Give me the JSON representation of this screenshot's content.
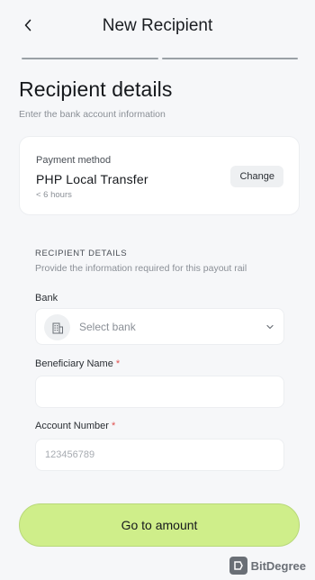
{
  "header": {
    "title": "New Recipient",
    "back_icon": "chevron-left-icon"
  },
  "progress": {
    "steps": 2,
    "current": 1
  },
  "page": {
    "title": "Recipient details",
    "subtitle": "Enter the bank account information"
  },
  "payment_method": {
    "label": "Payment method",
    "value": "PHP Local Transfer",
    "eta": "< 6 hours",
    "change_label": "Change"
  },
  "recipient_section": {
    "heading": "RECIPIENT DETAILS",
    "description": "Provide the information required for this payout rail"
  },
  "fields": {
    "bank": {
      "label": "Bank",
      "placeholder": "Select bank",
      "icon": "bank-building-icon"
    },
    "beneficiary": {
      "label": "Beneficiary Name",
      "required_mark": "*",
      "value": "",
      "placeholder": ""
    },
    "account_number": {
      "label": "Account Number",
      "required_mark": "*",
      "value": "",
      "placeholder": "123456789"
    }
  },
  "cta": {
    "label": "Go to amount"
  },
  "watermark": {
    "text": "BitDegree",
    "icon": "bitdegree-logo-icon"
  },
  "colors": {
    "background": "#f6f7f9",
    "card": "#ffffff",
    "accent": "#cfee8a",
    "required": "#e0514f"
  }
}
